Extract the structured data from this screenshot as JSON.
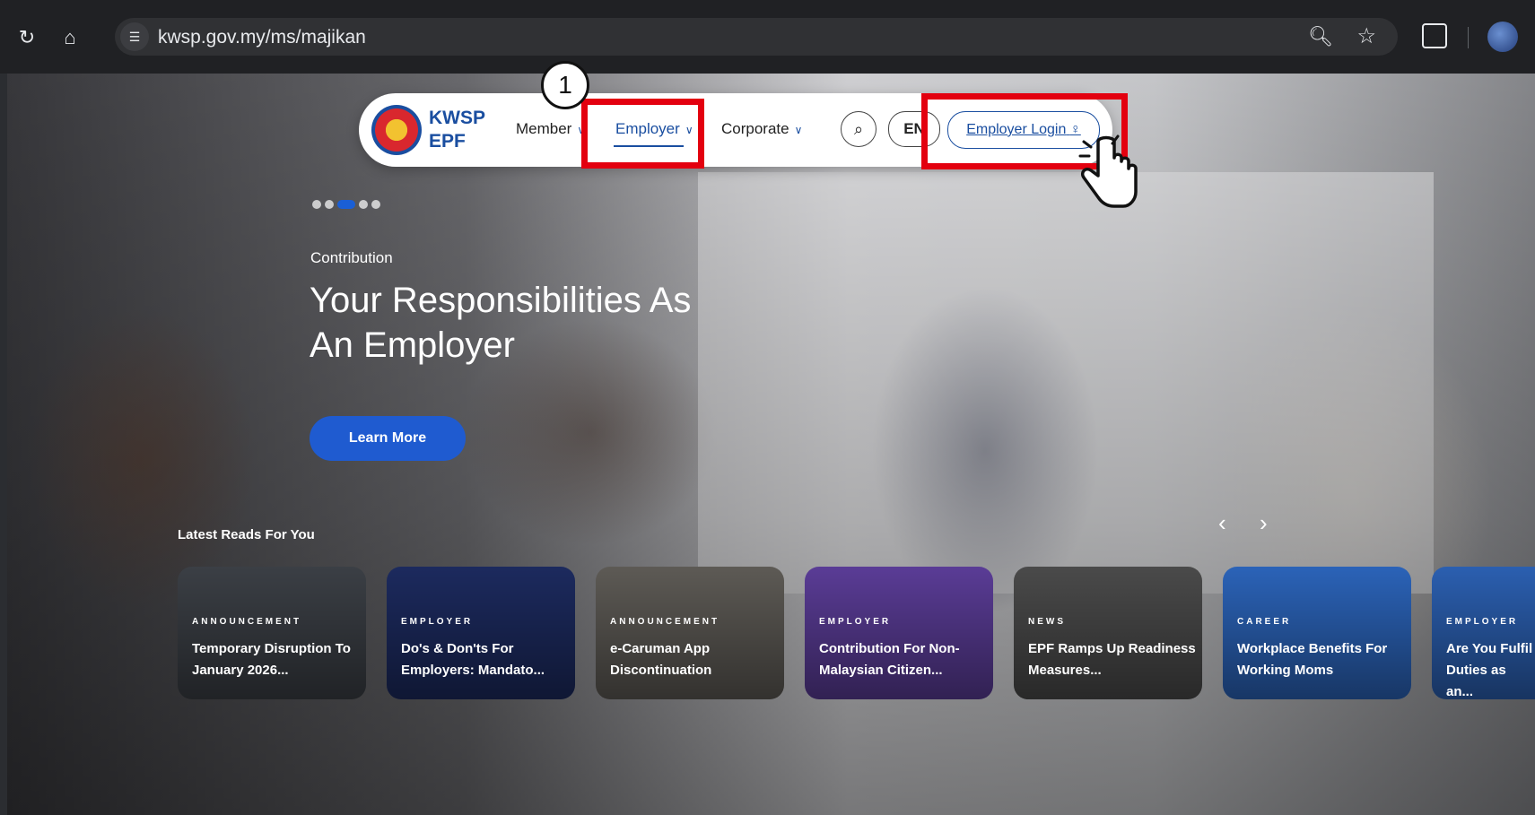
{
  "browser": {
    "url": "kwsp.gov.my/ms/majikan",
    "icons": [
      "reload-icon",
      "home-icon",
      "site-info-icon",
      "zoom-icon",
      "star-icon",
      "extensions-icon",
      "profile-avatar"
    ]
  },
  "nav": {
    "logo_line1": "KWSP",
    "logo_line2": "EPF",
    "member_label": "Member",
    "employer_label": "Employer",
    "corporate_label": "Corporate",
    "lang_label": "EN",
    "login_label": "Employer Login"
  },
  "annotation": {
    "step_number": "1",
    "highlight_color": "#e3000f"
  },
  "hero": {
    "category": "Contribution",
    "title": "Your Responsibilities As An Employer",
    "cta_label": "Learn More",
    "dots_total": 5,
    "dots_active_index": 2
  },
  "latest_reads": {
    "heading": "Latest Reads For You",
    "cards": [
      {
        "tag": "ANNOUNCEMENT",
        "title": "Temporary Disruption To January 2026...",
        "color": "#3b3f45"
      },
      {
        "tag": "EMPLOYER",
        "title": "Do's & Don'ts For Employers: Mandato...",
        "color": "#1c2a5e"
      },
      {
        "tag": "ANNOUNCEMENT",
        "title": "e-Caruman App Discontinuation",
        "color": "#5d5a55"
      },
      {
        "tag": "EMPLOYER",
        "title": "Contribution For Non-Malaysian Citizen...",
        "color": "#5a3c96"
      },
      {
        "tag": "NEWS",
        "title": "EPF Ramps Up Readiness Measures...",
        "color": "#4a4a4a"
      },
      {
        "tag": "CAREER",
        "title": "Workplace Benefits For Working Moms",
        "color": "#2b63b8"
      },
      {
        "tag": "EMPLOYER",
        "title": "Are You Fulfil Duties as an...",
        "color": "#2b5fb0"
      }
    ]
  },
  "colors": {
    "brand_blue": "#1a4ea0",
    "cta_blue": "#1f5bd0"
  }
}
